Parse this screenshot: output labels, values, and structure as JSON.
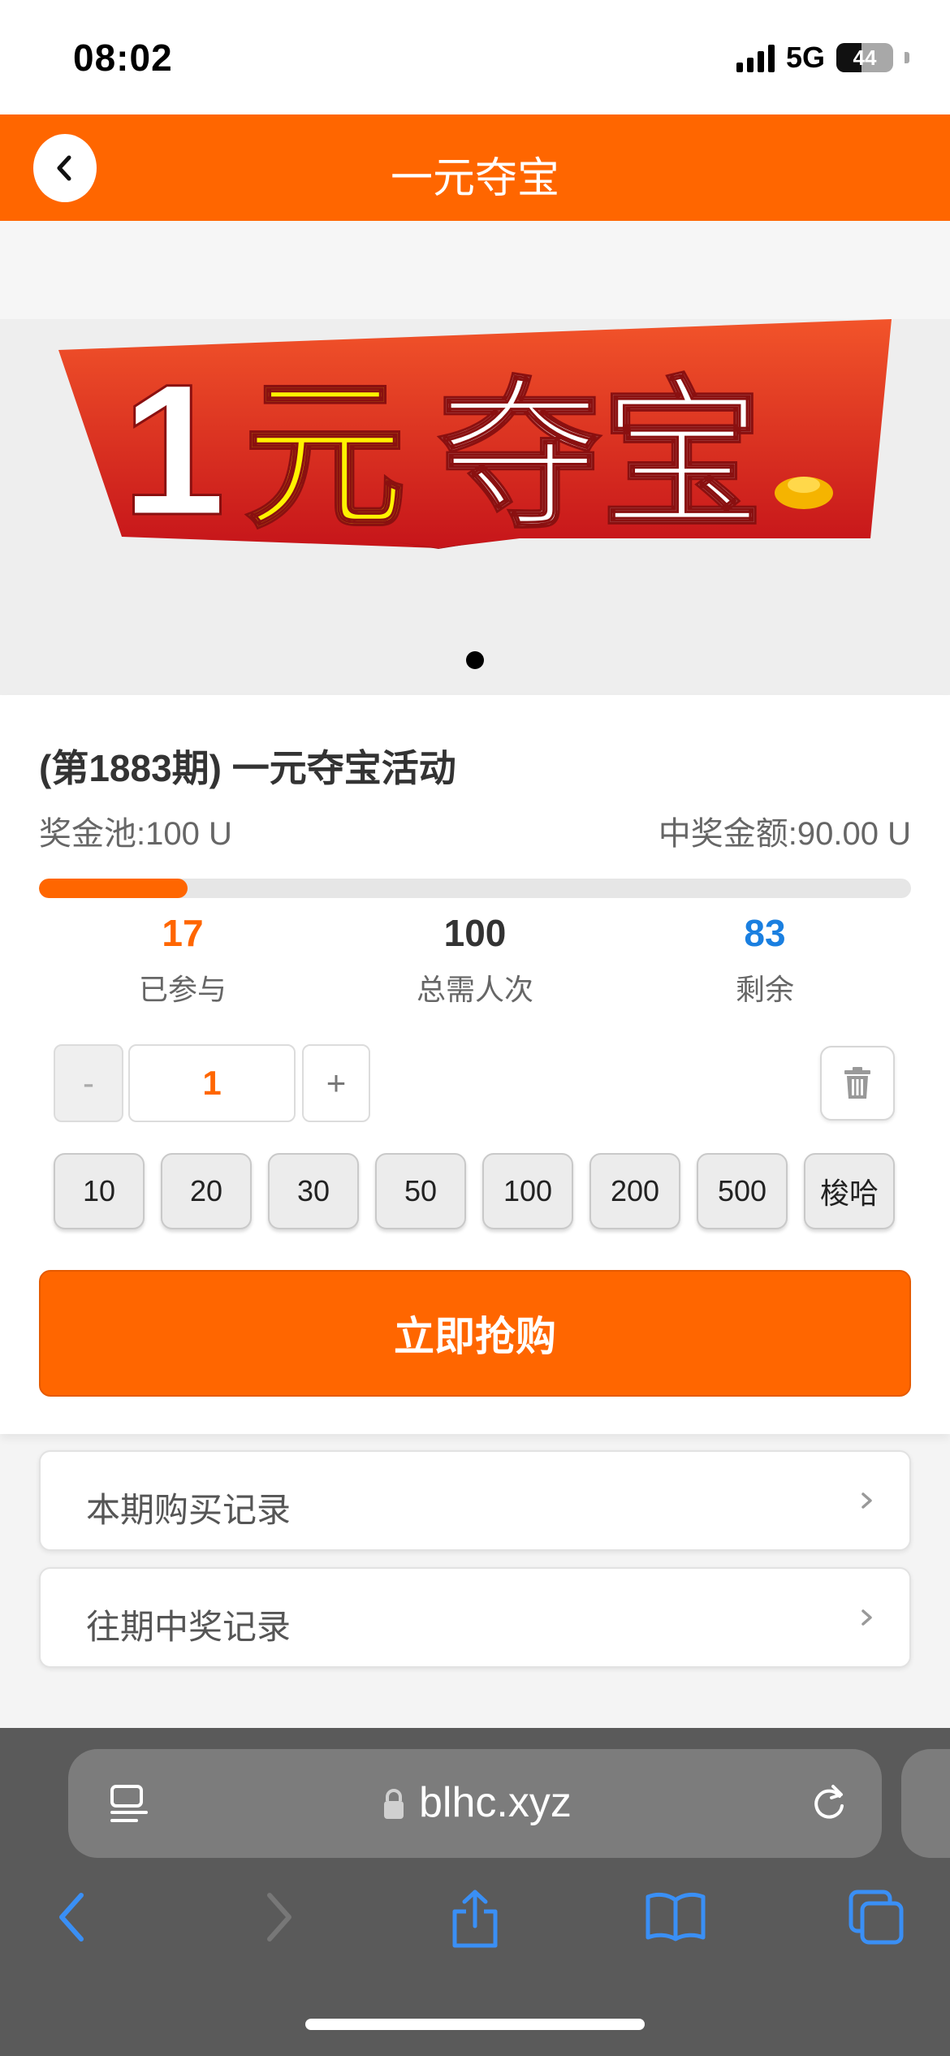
{
  "status_bar": {
    "time": "08:02",
    "network": "5G",
    "battery": "44"
  },
  "header": {
    "title": "一元夺宝"
  },
  "banner": {
    "text": "1元夺宝",
    "num": "1",
    "ch1": "元",
    "ch2": "夺宝",
    "slides": 1,
    "active_slide": 1
  },
  "activity": {
    "title": "(第1883期) 一元夺宝活动",
    "pool_label": "奖金池:100 U",
    "prize_label": "中奖金额:90.00 U",
    "progress": 0.17,
    "stats": [
      {
        "value": "17",
        "label": "已参与"
      },
      {
        "value": "100",
        "label": "总需人次"
      },
      {
        "value": "83",
        "label": "剩余"
      }
    ]
  },
  "quantity": {
    "minus": "-",
    "value": "1",
    "plus": "+"
  },
  "presets": [
    "10",
    "20",
    "30",
    "50",
    "100",
    "200",
    "500",
    "梭哈"
  ],
  "buy_button": "立即抢购",
  "records": [
    {
      "label": "本期购买记录"
    },
    {
      "label": "往期中奖记录"
    }
  ],
  "browser": {
    "url": "blhc.xyz"
  },
  "colors": {
    "accent": "#ff6600",
    "remaining": "#1a7fe0",
    "ios_blue": "#3a8ff5"
  },
  "icons": [
    "back-chevron-icon",
    "trash-icon",
    "chevron-right-icon",
    "lock-icon",
    "reader-icon",
    "reload-icon",
    "share-icon",
    "bookmarks-icon",
    "tabs-icon"
  ]
}
